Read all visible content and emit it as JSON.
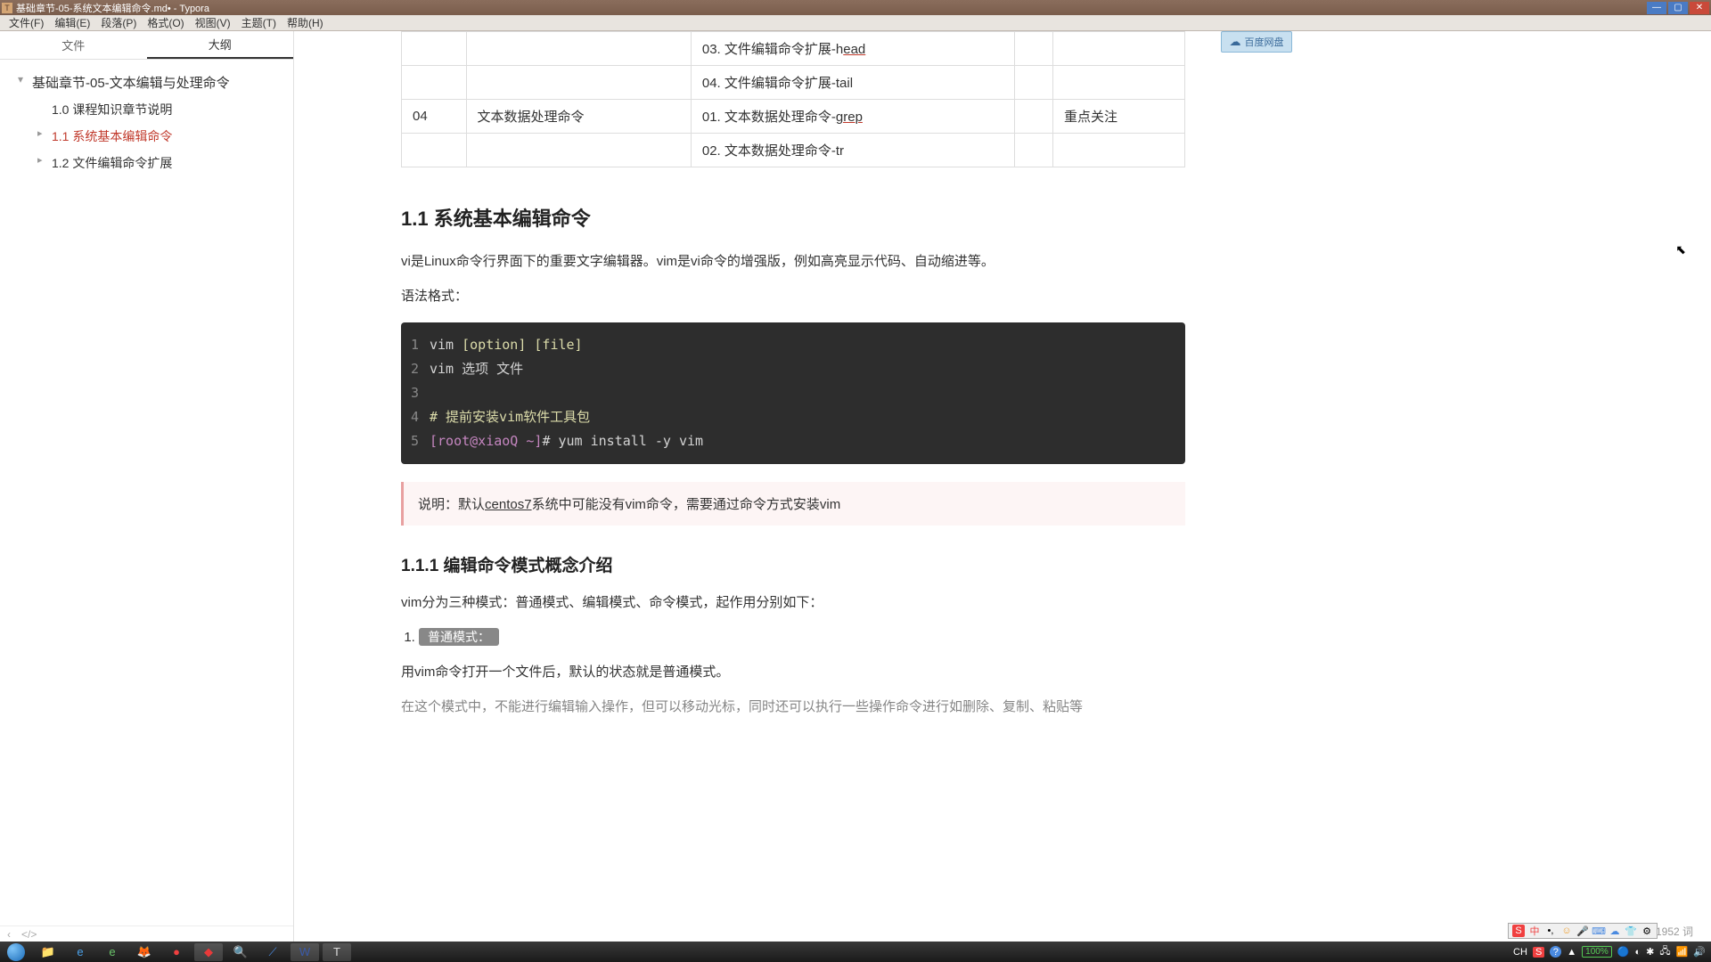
{
  "window": {
    "title": "基础章节-05-系统文本编辑命令.md• - Typora"
  },
  "menus": [
    "文件(F)",
    "编辑(E)",
    "段落(P)",
    "格式(O)",
    "视图(V)",
    "主题(T)",
    "帮助(H)"
  ],
  "sidebar": {
    "tabs": [
      "文件",
      "大纲"
    ],
    "outline": [
      {
        "level": 0,
        "label": "基础章节-05-文本编辑与处理命令",
        "active": false,
        "children": true
      },
      {
        "level": 1,
        "label": "1.0 课程知识章节说明",
        "active": false,
        "children": false
      },
      {
        "level": 1,
        "label": "1.1 系统基本编辑命令",
        "active": true,
        "children": true
      },
      {
        "level": 1,
        "label": "1.2 文件编辑命令扩展",
        "active": false,
        "children": true
      }
    ]
  },
  "cloud_btn": "百度网盘",
  "table": {
    "rows": [
      {
        "c1": "",
        "c2": "",
        "c3_pre": "03. 文件编辑命令扩展-h",
        "c3_link": "ead",
        "c4": "",
        "c5": ""
      },
      {
        "c1": "",
        "c2": "",
        "c3_pre": "04. 文件编辑命令扩展-tail",
        "c3_link": "",
        "c4": "",
        "c5": ""
      },
      {
        "c1": "04",
        "c2": "文本数据处理命令",
        "c3_pre": "01. 文本数据处理命令-",
        "c3_link": "grep",
        "c4": "",
        "c5": "重点关注"
      },
      {
        "c1": "",
        "c2": "",
        "c3_pre": "02. 文本数据处理命令-tr",
        "c3_link": "",
        "c4": "",
        "c5": ""
      }
    ]
  },
  "h2_1": "1.1 系统基本编辑命令",
  "para1": "vi是Linux命令行界面下的重要文字编辑器。vim是vi命令的增强版，例如高亮显示代码、自动缩进等。",
  "para2": "语法格式：",
  "code": {
    "lines": [
      {
        "n": "1",
        "parts": [
          {
            "t": "vim ",
            "c": ""
          },
          {
            "t": "[option]",
            "c": "tok-y"
          },
          {
            "t": " ",
            "c": ""
          },
          {
            "t": "[file]",
            "c": "tok-y"
          }
        ]
      },
      {
        "n": "2",
        "parts": [
          {
            "t": "vim 选项    文件",
            "c": ""
          }
        ]
      },
      {
        "n": "3",
        "parts": [
          {
            "t": "",
            "c": ""
          }
        ]
      },
      {
        "n": "4",
        "parts": [
          {
            "t": "# 提前安装vim软件工具包",
            "c": "tok-c"
          }
        ]
      },
      {
        "n": "5",
        "parts": [
          {
            "t": "[root@xiaoQ ~]",
            "c": "tok-p"
          },
          {
            "t": "# yum install -y vim",
            "c": ""
          }
        ]
      }
    ]
  },
  "note": {
    "pre": "说明：默认",
    "link": "centos7",
    "post": "系统中可能没有vim命令，需要通过命令方式安装vim"
  },
  "h3_1": "1.1.1 编辑命令模式概念介绍",
  "para3": "vim分为三种模式：普通模式、编辑模式、命令模式，起作用分别如下：",
  "ol": [
    {
      "pill": "普通模式："
    }
  ],
  "para4": "用vim命令打开一个文件后，默认的状态就是普通模式。",
  "para5": "在这个模式中，不能进行编辑输入操作，但可以移动光标，同时还可以执行一些操作命令进行如删除、复制、粘贴等",
  "footer": {
    "back": "‹",
    "code": "</>",
    "words": "1952 词"
  },
  "ime": {
    "icons": [
      "S",
      "中",
      "•,",
      "☺",
      "🎤",
      "⌨",
      "☁",
      "👕",
      "⚙"
    ]
  },
  "taskbar": {
    "items": [
      {
        "icon": "📁",
        "c": "#f0d070"
      },
      {
        "icon": "e",
        "c": "#4aa0e8"
      },
      {
        "icon": "e",
        "c": "#6ac46a"
      },
      {
        "icon": "🦊",
        "c": "#f08030"
      },
      {
        "icon": "●",
        "c": "#f04040"
      },
      {
        "icon": "◆",
        "c": "#e83a3a",
        "active": true
      },
      {
        "icon": "🔍",
        "c": "#f0a050"
      },
      {
        "icon": "⟋",
        "c": "#4a8ae0"
      },
      {
        "icon": "W",
        "c": "#3a5aaa",
        "active": true
      },
      {
        "icon": "T",
        "c": "#ddd",
        "active": true
      }
    ],
    "tray": {
      "ch": "CH",
      "s": "S",
      "q": "?",
      "up": "▲",
      "bat": "100%",
      "icons": [
        "🔵",
        "◐",
        "✱",
        "🖧",
        "📶",
        "🔊"
      ],
      "time": ""
    }
  }
}
